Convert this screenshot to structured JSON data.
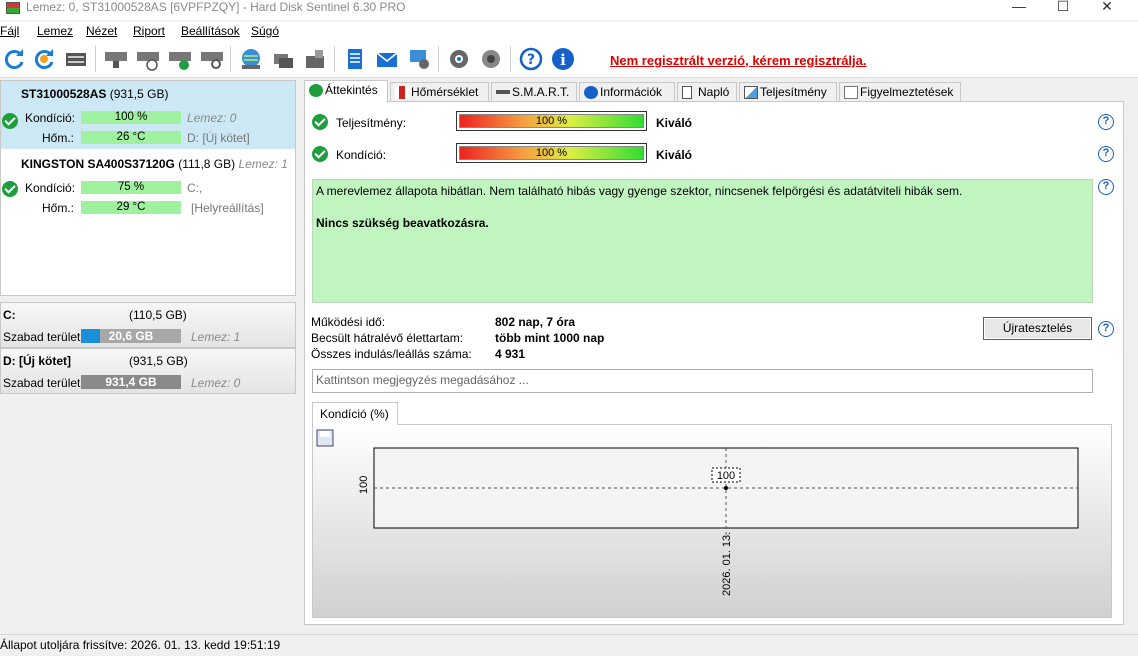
{
  "window": {
    "title": "Lemez: 0, ST31000528AS [6VPFPZQY]  -  Hard Disk Sentinel 6.30 PRO",
    "minimize": "—",
    "maximize": "☐",
    "close": "✕"
  },
  "menu": [
    "Fájl",
    "Lemez",
    "Nézet",
    "Riport",
    "Beállítások",
    "Súgó"
  ],
  "toolbar": {
    "icons": [
      "refresh-icon",
      "refresh-all-icon",
      "disk-info-icon",
      "disk-sleep-icon",
      "disk-schedule-icon",
      "disk-test-icon",
      "disk-search-icon",
      "network-globe-icon",
      "backup-icon",
      "export-icon",
      "notepad-icon",
      "email-icon",
      "network-icon",
      "settings-icon",
      "sound-icon",
      "help-icon",
      "info-icon"
    ],
    "unregistered": "Nem regisztrált verzió, kérem regisztrálja."
  },
  "disks": [
    {
      "name": "ST31000528AS",
      "size": "(931,5 GB)",
      "disk_index": "",
      "health_label": "Kondíció:",
      "health": "100 %",
      "health_disk": "Lemez: 0",
      "temp_label": "Hőm.:",
      "temp": "26 °C",
      "partitions": "D: [Új kötet]"
    },
    {
      "name": "KINGSTON SA400S37120G",
      "size": "(111,8 GB)",
      "disk_index": "Lemez: 1",
      "health_label": "Kondíció:",
      "health": "75 %",
      "health_disk": "C:,",
      "temp_label": "Hőm.:",
      "temp": "29 °C",
      "partitions": "[Helyreállítás]"
    }
  ],
  "partitions": [
    {
      "name": "C:",
      "size": "(110,5 GB)",
      "free_label": "Szabad terület",
      "free": "20,6 GB",
      "free_fraction": 0.19,
      "color": "#1a8fd8",
      "disk": "Lemez: 1"
    },
    {
      "name": "D: [Új kötet]",
      "size": "(931,5 GB)",
      "free_label": "Szabad terület",
      "free": "931,4 GB",
      "free_fraction": 1.0,
      "color": "#8a8a8a",
      "disk": "Lemez: 0"
    }
  ],
  "tabs": [
    "Áttekintés",
    "Hőmérséklet",
    "S.M.A.R.T.",
    "Információk",
    "Napló",
    "Teljesítmény",
    "Figyelmeztetések"
  ],
  "overview": {
    "performance_label": "Teljesítmény:",
    "performance_value": "100 %",
    "performance_rating": "Kiváló",
    "health_label": "Kondíció:",
    "health_value": "100 %",
    "health_rating": "Kiváló",
    "message": "A merevlemez állapota hibátlan. Nem található hibás vagy gyenge szektor, nincsenek felpörgési és adatátviteli hibák sem.",
    "message_action": "Nincs szükség beavatkozásra.",
    "uptime_label": "Működési idő:",
    "uptime_value": "802 nap, 7 óra",
    "lifetime_label": "Becsült hátralévő élettartam:",
    "lifetime_value": "több mint 1000 nap",
    "starts_label": "Összes indulás/leállás száma:",
    "starts_value": "4 931",
    "retest_button": "Újratesztelés",
    "help": "?",
    "note_placeholder": "Kattintson megjegyzés megadásához ..."
  },
  "chart_tab": "Kondíció  (%)",
  "chart_data": {
    "type": "line",
    "x": [
      "2026. 01. 13."
    ],
    "series": [
      {
        "values": [
          100
        ]
      }
    ],
    "y_tick_labels": [
      "100"
    ],
    "data_labels": [
      "100"
    ],
    "grid": true
  },
  "status": "Állapot utoljára frissítve: 2026. 01. 13. kedd 19:51:19"
}
